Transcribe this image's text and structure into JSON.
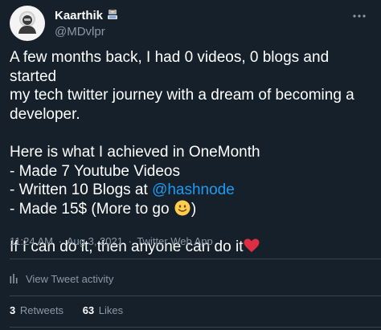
{
  "author": {
    "display_name": "Kaarthik",
    "handle": "@MDvlpr",
    "name_emoji": "technologist-emoji"
  },
  "tweet": {
    "line1": "A few months back, I had 0 videos, 0 blogs and started",
    "line2": "my tech twitter journey with a dream of becoming a",
    "line3": "developer.",
    "line4": "Here is what I achieved in OneMonth",
    "line5": "- Made 7 Youtube Videos",
    "line6_prefix": "- Written 10 Blogs at ",
    "line6_mention": "@hashnode",
    "line7": "- Made 15$ (More to go ",
    "line7_suffix": ")",
    "line8": "If I can do it, then anyone can do it"
  },
  "meta": {
    "time": "11:24 AM",
    "date": "Aug 3, 2021",
    "source": "Twitter Web App",
    "separator": "·"
  },
  "activity": {
    "label": "View Tweet activity"
  },
  "stats": {
    "retweets_count": "3",
    "retweets_label": "Retweets",
    "likes_count": "63",
    "likes_label": "Likes"
  },
  "colors": {
    "background": "#15202b",
    "text": "#ffffff",
    "secondary": "#8b98a5",
    "link": "#1d9bf0",
    "divider": "#38444d"
  }
}
